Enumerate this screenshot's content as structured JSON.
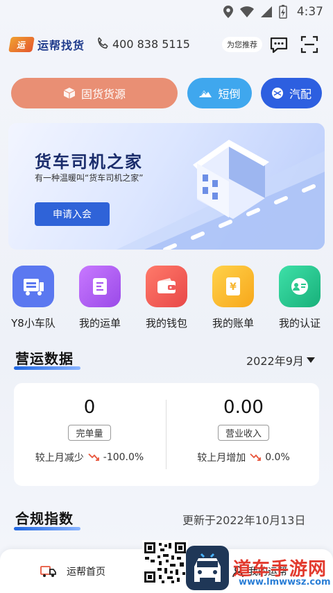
{
  "status_bar": {
    "time": "4:37"
  },
  "header": {
    "logo_mark": "运",
    "logo_text": "运帮找货",
    "phone": "400 838 5115",
    "recommend": "为您推荐"
  },
  "actions": {
    "goods": "固货货源",
    "short": "短倒",
    "auto": "汽配"
  },
  "banner": {
    "title": "货车司机之家",
    "subtitle": "有一种温暖叫“货车司机之家”",
    "button": "申请入会"
  },
  "shortcuts": [
    {
      "label": "Y8小车队",
      "color": "#5b78f0",
      "icon": "truck-fleet-icon"
    },
    {
      "label": "我的运单",
      "color": "#b05ff0",
      "icon": "waybill-icon"
    },
    {
      "label": "我的钱包",
      "color": "#f05a5a",
      "icon": "wallet-icon"
    },
    {
      "label": "我的账单",
      "color": "#f7b733",
      "icon": "bill-icon"
    },
    {
      "label": "我的认证",
      "color": "#2cc98f",
      "icon": "id-card-icon"
    }
  ],
  "operations": {
    "title": "营运数据",
    "month": "2022年9月",
    "stats": [
      {
        "value": "0",
        "tag": "完单量",
        "compare_label": "较上月减少",
        "compare_value": "-100.0%"
      },
      {
        "value": "0.00",
        "tag": "营业收入",
        "compare_label": "较上月增加",
        "compare_value": "0.0%"
      }
    ]
  },
  "compliance": {
    "title": "合规指数",
    "updated": "更新于2022年10月13日"
  },
  "bottom_nav": {
    "home": "运帮首页",
    "mine": "我的运帮"
  },
  "watermark": {
    "text": "道车手游网",
    "url": "www.lmwwsz.com"
  }
}
